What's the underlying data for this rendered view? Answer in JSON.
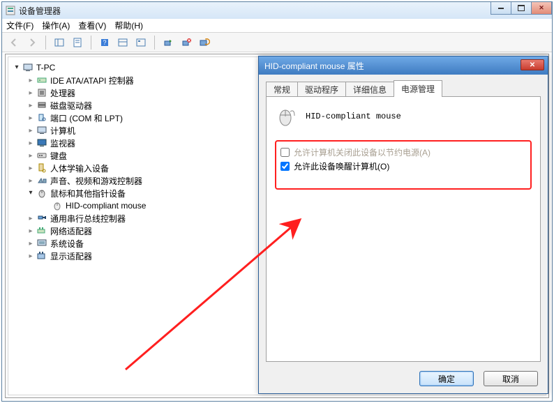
{
  "mainWindow": {
    "title": "设备管理器"
  },
  "menus": {
    "file": "文件(F)",
    "action": "操作(A)",
    "view": "查看(V)",
    "help": "帮助(H)"
  },
  "tree": {
    "root": "T-PC",
    "nodes": [
      "IDE ATA/ATAPI 控制器",
      "处理器",
      "磁盘驱动器",
      "端口 (COM 和 LPT)",
      "计算机",
      "监视器",
      "键盘",
      "人体学输入设备",
      "声音、视频和游戏控制器"
    ],
    "pointingDevices": "鼠标和其他指针设备",
    "hidMouse": "HID-compliant mouse",
    "tailNodes": [
      "通用串行总线控制器",
      "网络适配器",
      "系统设备",
      "显示适配器"
    ]
  },
  "dialog": {
    "title": "HID-compliant mouse 属性",
    "tabs": {
      "general": "常规",
      "driver": "驱动程序",
      "details": "详细信息",
      "power": "电源管理"
    },
    "deviceName": "HID-compliant mouse",
    "allowOffLabel": "允许计算机关闭此设备以节约电源(A)",
    "allowWakeLabel": "允许此设备唤醒计算机(O)",
    "allowOffChecked": false,
    "allowWakeChecked": true,
    "ok": "确定",
    "cancel": "取消"
  }
}
